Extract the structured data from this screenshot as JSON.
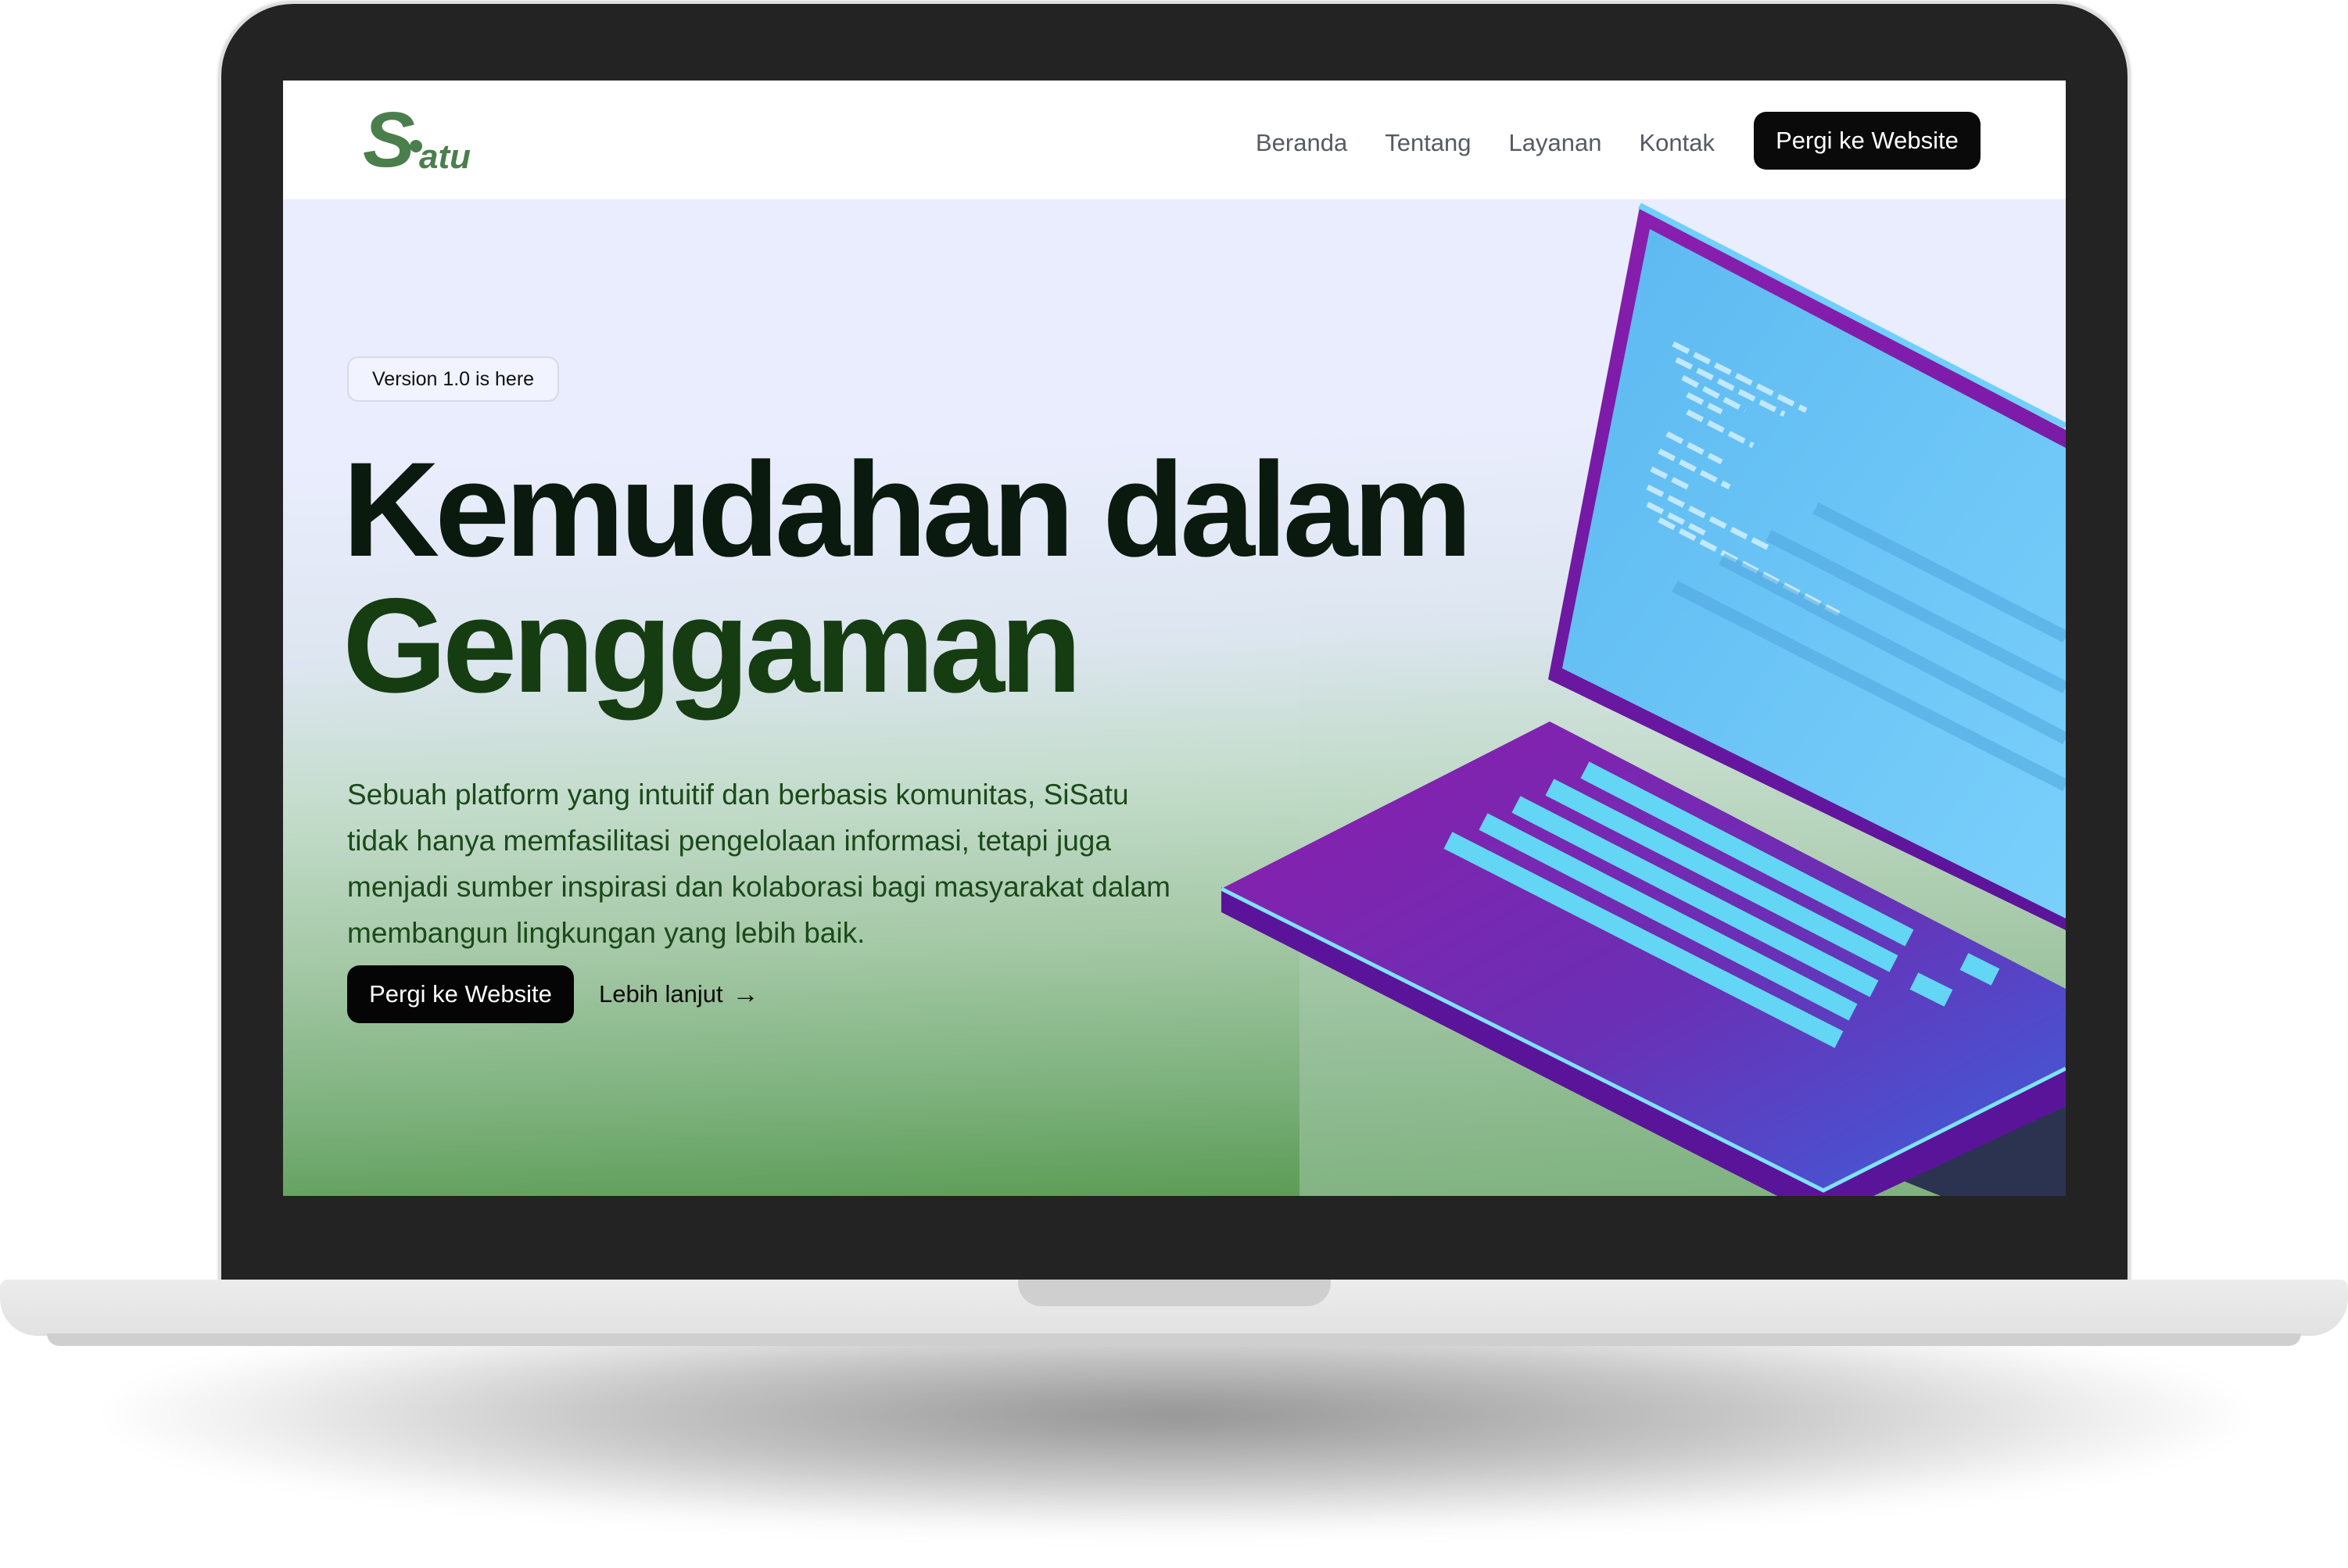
{
  "brand": {
    "logo_initial": "S",
    "logo_rest": "atu",
    "color": "#4a7f4c"
  },
  "nav": {
    "links": [
      "Beranda",
      "Tentang",
      "Layanan",
      "Kontak"
    ],
    "cta_label": "Pergi ke Website"
  },
  "hero": {
    "badge": "Version 1.0 is here",
    "headline_line1": "Kemudahan dalam",
    "headline_line2": "Genggaman",
    "description": "Sebuah platform yang intuitif dan berbasis komunitas, SiSatu tidak hanya memfasilitasi pengelolaan informasi, tetapi juga menjadi sumber inspirasi dan kolaborasi bagi masyarakat dalam membangun lingkungan yang lebih baik.",
    "primary_cta": "Pergi ke Website",
    "secondary_cta": "Lebih lanjut",
    "secondary_icon": "arrow-right-icon"
  },
  "colors": {
    "headline_dark": "#0b1a0e",
    "headline_green": "#163d12",
    "description_green": "#1b4a1a",
    "button_black": "#050505",
    "hero_top": "#eaedfd",
    "hero_bottom": "#54984d"
  },
  "illustration": {
    "name": "isometric-laptop-illustration"
  }
}
